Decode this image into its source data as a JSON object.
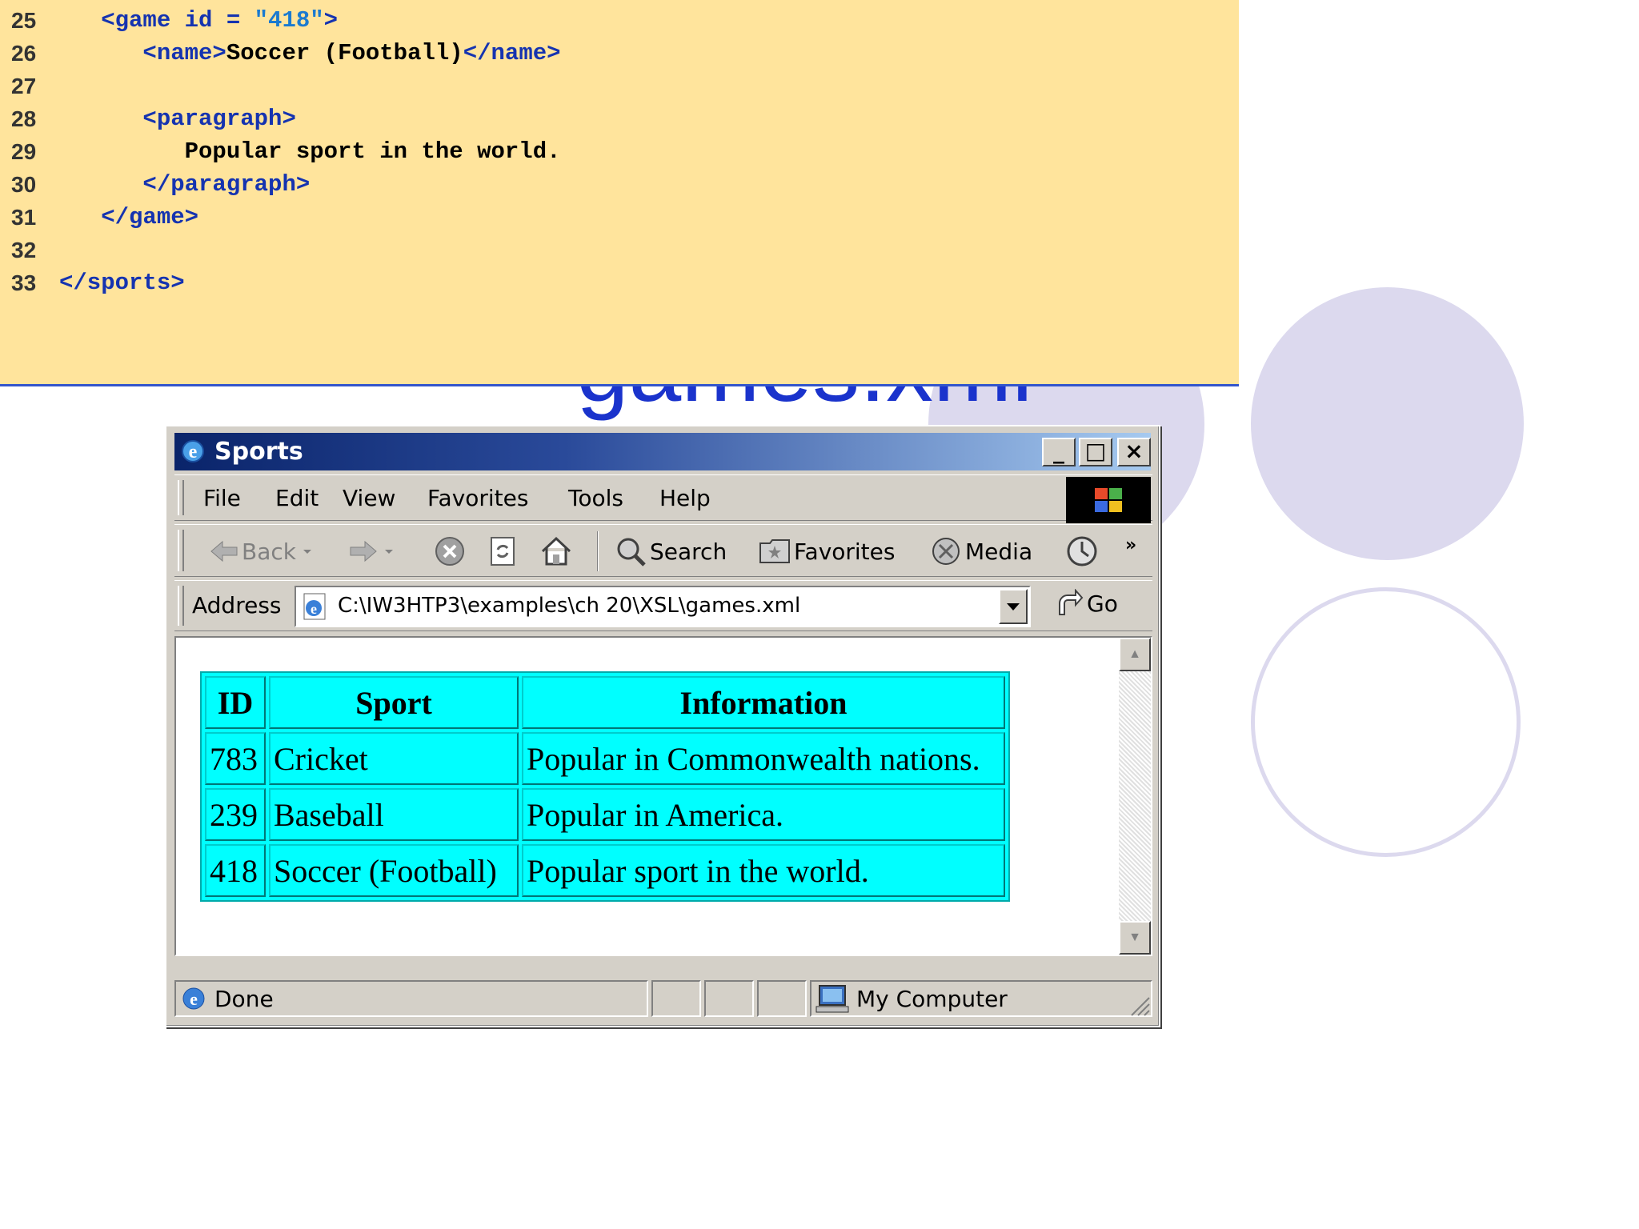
{
  "slide": {
    "title_fragment": "games.xml"
  },
  "code": {
    "lines": [
      {
        "num": "25",
        "parts": [
          {
            "cls": "tag",
            "text": "   <game id = "
          },
          {
            "cls": "str",
            "text": "\"418\""
          },
          {
            "cls": "tag",
            "text": ">"
          }
        ]
      },
      {
        "num": "26",
        "parts": [
          {
            "cls": "tag",
            "text": "      <name>"
          },
          {
            "cls": "txt",
            "text": "Soccer (Football)"
          },
          {
            "cls": "tag",
            "text": "</name>"
          }
        ]
      },
      {
        "num": "27",
        "parts": []
      },
      {
        "num": "28",
        "parts": [
          {
            "cls": "tag",
            "text": "      <paragraph>"
          }
        ]
      },
      {
        "num": "29",
        "parts": [
          {
            "cls": "txt",
            "text": "         Popular sport in the world."
          }
        ]
      },
      {
        "num": "30",
        "parts": [
          {
            "cls": "tag",
            "text": "      </paragraph>"
          }
        ]
      },
      {
        "num": "31",
        "parts": [
          {
            "cls": "tag",
            "text": "   </game>"
          }
        ]
      },
      {
        "num": "32",
        "parts": []
      },
      {
        "num": "33",
        "parts": [
          {
            "cls": "tag",
            "text": "</sports>"
          }
        ]
      }
    ]
  },
  "window": {
    "title": "Sports",
    "menu": [
      "File",
      "Edit",
      "View",
      "Favorites",
      "Tools",
      "Help"
    ],
    "toolbar": {
      "back": "Back",
      "search": "Search",
      "favorites": "Favorites",
      "media": "Media",
      "more": "»"
    },
    "address": {
      "label": "Address",
      "value": "C:\\IW3HTP3\\examples\\ch 20\\XSL\\games.xml",
      "go": "Go"
    },
    "table": {
      "headers": [
        "ID",
        "Sport",
        "Information"
      ],
      "rows": [
        [
          "783",
          "Cricket",
          "Popular in Commonwealth nations."
        ],
        [
          "239",
          "Baseball",
          "Popular in America."
        ],
        [
          "418",
          "Soccer (Football)",
          "Popular sport in the world."
        ]
      ]
    },
    "status": {
      "text": "Done",
      "zone": "My Computer"
    }
  },
  "colors": {
    "code_bg": "#ffe49c",
    "tag": "#1533b0",
    "table_bg": "#00ffff",
    "circle": "#dcd9ee"
  }
}
